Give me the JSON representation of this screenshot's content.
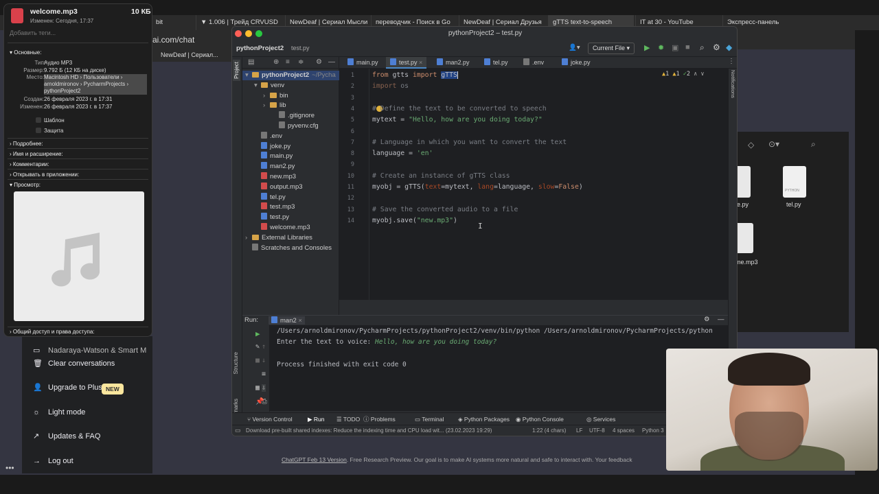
{
  "info": {
    "filename": "welcome.mp3",
    "size_short": "10 КБ",
    "modified_short": "Изменен: Сегодня, 17:37",
    "tags_placeholder": "Добавить теги...",
    "section_basic": "Основные:",
    "type_label": "Тип:",
    "type_value": "Аудио MP3",
    "size_label": "Размер:",
    "size_value": "9.792 Б (12 КБ на диске)",
    "where_label": "Место:",
    "where_value_1": "Macintosh HD › Пользователи ›",
    "where_value_2": "arnoldmironov › PycharmProjects ›",
    "where_value_3": "pythonProject2",
    "created_label": "Создан:",
    "created_value": "26 февраля 2023 г. в 17:31",
    "changed_label": "Изменен:",
    "changed_value": "26 февраля 2023 г. в 17:37",
    "template": "Шаблон",
    "locked": "Защита",
    "more": "Подробнее:",
    "name_ext": "Имя и расширение:",
    "comments": "Комментарии:",
    "open_with": "Открывать в приложении:",
    "preview": "Просмотр:",
    "sharing": "Общий доступ и права доступа:"
  },
  "browser": {
    "tabs": [
      "bit",
      "▼ 1.006 | Трейд CRVUSD",
      "NewDeaf | Сериал Мысли",
      "переводчик - Поиск в Go",
      "NewDeaf | Сериал Друзья",
      "gTTS text-to-speech",
      "IT at 30 - YouTube",
      "Экспресс-панель"
    ],
    "url_fragment": "ai.com/chat",
    "bookmark": "NewDeaf | Сериал..."
  },
  "chatgpt": {
    "truncated_item": "Nadaraya-Watson & Smart M",
    "clear": "Clear conversations",
    "upgrade": "Upgrade to Plus",
    "new_badge": "NEW",
    "light": "Light mode",
    "updates": "Updates & FAQ",
    "logout": "Log out",
    "footer_link": "ChatGPT Feb 13 Version",
    "footer_text": ". Free Research Preview. Our goal is to make AI systems more natural and safe to interact with. Your feedback"
  },
  "finder": {
    "file1": "e.py",
    "file2": "tel.py",
    "file3": "me.mp3",
    "python_label": "PYTHON"
  },
  "ide": {
    "title": "pythonProject2 – test.py",
    "project_name": "pythonProject2",
    "crumb_file": "test.py",
    "run_config": "Current File",
    "project_tab": "Project",
    "tree": [
      {
        "label": "pythonProject2",
        "extra": "~/Pycha",
        "indent": 0,
        "icon": "folder",
        "arrow": "▾"
      },
      {
        "label": "venv",
        "indent": 1,
        "icon": "folder",
        "arrow": "▾"
      },
      {
        "label": "bin",
        "indent": 2,
        "icon": "folder",
        "arrow": "›"
      },
      {
        "label": "lib",
        "indent": 2,
        "icon": "folder",
        "arrow": "›"
      },
      {
        "label": ".gitignore",
        "indent": 3,
        "icon": "txt",
        "arrow": ""
      },
      {
        "label": "pyvenv.cfg",
        "indent": 3,
        "icon": "txt",
        "arrow": ""
      },
      {
        "label": ".env",
        "indent": 1,
        "icon": "txt",
        "arrow": ""
      },
      {
        "label": "joke.py",
        "indent": 1,
        "icon": "py",
        "arrow": ""
      },
      {
        "label": "main.py",
        "indent": 1,
        "icon": "py",
        "arrow": ""
      },
      {
        "label": "man2.py",
        "indent": 1,
        "icon": "py",
        "arrow": ""
      },
      {
        "label": "new.mp3",
        "indent": 1,
        "icon": "mp3",
        "arrow": ""
      },
      {
        "label": "output.mp3",
        "indent": 1,
        "icon": "mp3",
        "arrow": ""
      },
      {
        "label": "tel.py",
        "indent": 1,
        "icon": "py",
        "arrow": ""
      },
      {
        "label": "test.mp3",
        "indent": 1,
        "icon": "mp3",
        "arrow": ""
      },
      {
        "label": "test.py",
        "indent": 1,
        "icon": "py",
        "arrow": ""
      },
      {
        "label": "welcome.mp3",
        "indent": 1,
        "icon": "mp3",
        "arrow": ""
      },
      {
        "label": "External Libraries",
        "indent": 0,
        "icon": "folder",
        "arrow": "›"
      },
      {
        "label": "Scratches and Consoles",
        "indent": 0,
        "icon": "txt",
        "arrow": ""
      }
    ],
    "editor_tabs": [
      "main.py",
      "test.py",
      "man2.py",
      "tel.py",
      ".env",
      "joke.py"
    ],
    "active_tab": "test.py",
    "inspections": {
      "warn": "1",
      "weak": "1",
      "ok": "2"
    },
    "line_numbers": [
      "1",
      "2",
      "3",
      "4",
      "5",
      "6",
      "7",
      "8",
      "9",
      "10",
      "11",
      "12",
      "13",
      "14"
    ],
    "run_label": "Run:",
    "run_name": "man2",
    "output": {
      "cmd": "/Users/arnoldmironov/PycharmProjects/pythonProject2/venv/bin/python /Users/arnoldmironov/PycharmProjects/python",
      "prompt": "Enter the text to voice: ",
      "input": "Hello, how are you doing today?",
      "finished": "Process finished with exit code 0"
    },
    "bottom_tabs": [
      "Version Control",
      "Run",
      "TODO",
      "Problems",
      "Terminal",
      "Python Packages",
      "Python Console",
      "Services"
    ],
    "side_labels": {
      "structure": "Structure",
      "bookmarks": "Bookmarks",
      "notifications": "Notifications"
    },
    "status": {
      "message": "Download pre-built shared indexes: Reduce the indexing time and CPU load wit... (23.02.2023 19:29)",
      "position": "1:22 (4 chars)",
      "eol": "LF",
      "encoding": "UTF-8",
      "indent": "4 spaces",
      "interpreter": "Python 3"
    }
  }
}
